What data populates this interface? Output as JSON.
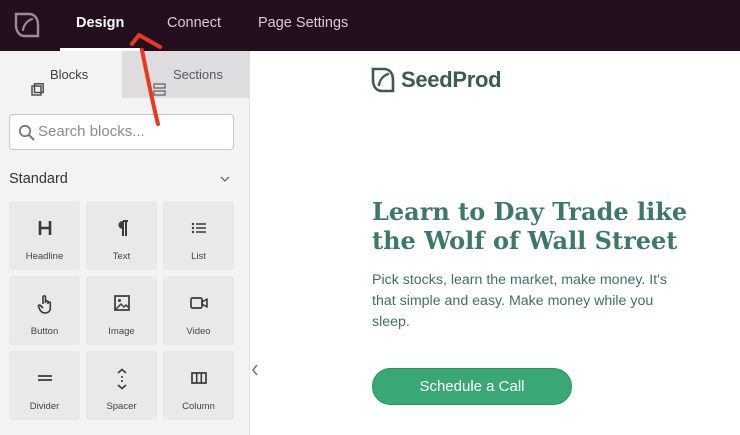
{
  "topbar": {
    "tabs": [
      {
        "label": "Design"
      },
      {
        "label": "Connect"
      },
      {
        "label": "Page Settings"
      }
    ]
  },
  "sidebar": {
    "tabs": [
      {
        "label": "Blocks"
      },
      {
        "label": "Sections"
      }
    ],
    "search": {
      "placeholder": "Search blocks..."
    },
    "section_title": "Standard",
    "blocks": [
      {
        "label": "Headline",
        "icon": "headline-icon"
      },
      {
        "label": "Text",
        "icon": "paragraph-icon"
      },
      {
        "label": "List",
        "icon": "list-icon"
      },
      {
        "label": "Button",
        "icon": "pointer-icon"
      },
      {
        "label": "Image",
        "icon": "image-icon"
      },
      {
        "label": "Video",
        "icon": "video-icon"
      },
      {
        "label": "Divider",
        "icon": "divider-icon"
      },
      {
        "label": "Spacer",
        "icon": "spacer-icon"
      },
      {
        "label": "Column",
        "icon": "column-icon"
      }
    ]
  },
  "main": {
    "brand": "SeedProd",
    "headline": "Learn to Day Trade like the Wolf of Wall Street",
    "subtext": "Pick stocks, learn the market, make money. It's that simple and easy. Make money while you sleep.",
    "cta": "Schedule a Call"
  },
  "colors": {
    "topbar": "#230f1f",
    "brand_text": "#3a5b54",
    "headline": "#3e776d",
    "cta": "#3aa876",
    "annotation_arrow": "#e8391c"
  }
}
